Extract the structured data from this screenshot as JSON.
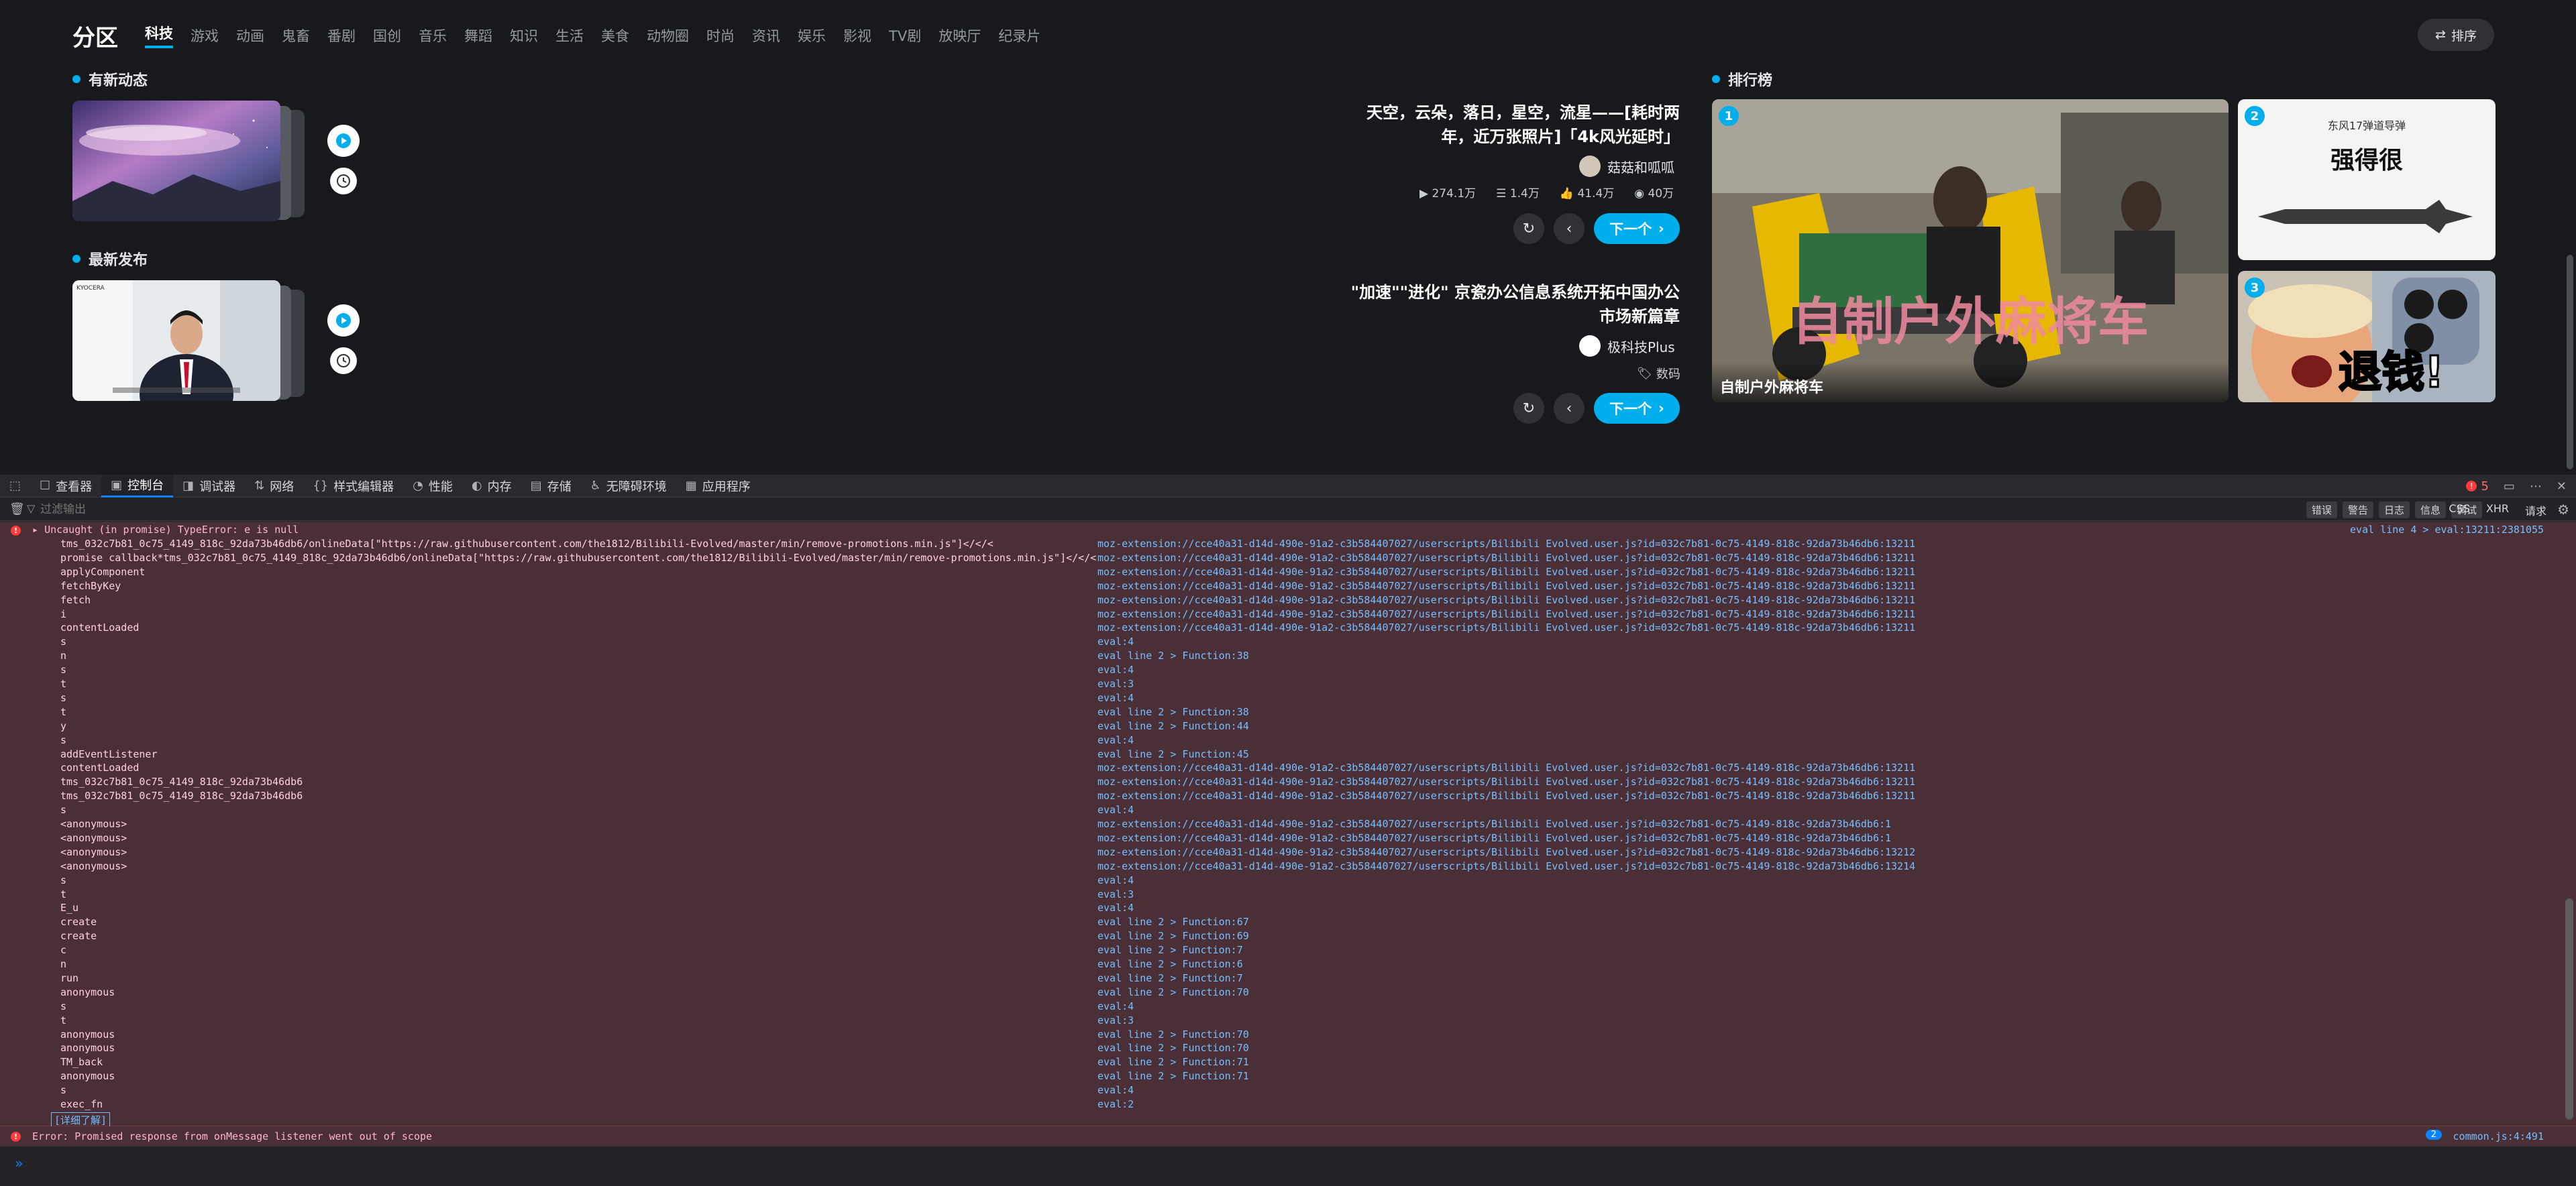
{
  "header": {
    "zone_title": "分区",
    "categories": [
      "科技",
      "游戏",
      "动画",
      "鬼畜",
      "番剧",
      "国创",
      "音乐",
      "舞蹈",
      "知识",
      "生活",
      "美食",
      "动物圈",
      "时尚",
      "资讯",
      "娱乐",
      "影视",
      "TV剧",
      "放映厅",
      "纪录片"
    ],
    "active_category": "科技",
    "sort_label": "排序"
  },
  "sections": {
    "dynamic_title": "有新动态",
    "latest_title": "最新发布",
    "rank_title": "排行榜"
  },
  "dynamic_video": {
    "title_line1": "天空，云朵，落日，星空，流星——[耗时两",
    "title_line2": "年，近万张照片]「4k风光延时」",
    "author": "菇菇和呱呱",
    "stats": {
      "views": "274.1万",
      "danmaku": "1.4万",
      "likes": "41.4万",
      "coins": "40万"
    },
    "next_label": "下一个"
  },
  "latest_video": {
    "title_line1": "\"加速\"\"进化\" 京瓷办公信息系统开拓中国办公",
    "title_line2": "市场新篇章",
    "author": "极科技Plus",
    "tag": "数码",
    "next_label": "下一个"
  },
  "ranking": [
    {
      "rank": "1",
      "caption": "自制户外麻将车",
      "overlay": "自制户外麻将车"
    },
    {
      "rank": "2",
      "top_text": "东风17弹道导弹",
      "big_text": "强得很"
    },
    {
      "rank": "3",
      "overlay": "退钱!"
    }
  ],
  "devtools": {
    "tabs": [
      "查看器",
      "控制台",
      "调试器",
      "网络",
      "样式编辑器",
      "性能",
      "内存",
      "存储",
      "无障碍环境",
      "应用程序"
    ],
    "active_tab": "控制台",
    "error_count": "5",
    "filter_placeholder": "过滤输出",
    "filter_buttons": [
      "错误",
      "警告",
      "日志",
      "信息",
      "调试"
    ],
    "filter_extra": [
      "CSS",
      "XHR",
      "请求"
    ],
    "error_message": "Uncaught (in promise) TypeError: e is null",
    "error_location": "eval line 4 > eval:13211:2381055",
    "stack": [
      {
        "fn": "tms_032c7b81_0c75_4149_818c_92da73b46db6/onlineData[\"https://raw.githubusercontent.com/the1812/Bilibili-Evolved/master/min/remove-promotions.min.js\"]</</<",
        "loc": "moz-extension://cce40a31-d14d-490e-91a2-c3b584407027/userscripts/Bilibili Evolved.user.js?id=032c7b81-0c75-4149-818c-92da73b46db6:13211"
      },
      {
        "fn": "promise callback*tms_032c7b81_0c75_4149_818c_92da73b46db6/onlineData[\"https://raw.githubusercontent.com/the1812/Bilibili-Evolved/master/min/remove-promotions.min.js\"]</</<",
        "loc": "moz-extension://cce40a31-d14d-490e-91a2-c3b584407027/userscripts/Bilibili Evolved.user.js?id=032c7b81-0c75-4149-818c-92da73b46db6:13211"
      },
      {
        "fn": "applyComponent",
        "loc": "moz-extension://cce40a31-d14d-490e-91a2-c3b584407027/userscripts/Bilibili Evolved.user.js?id=032c7b81-0c75-4149-818c-92da73b46db6:13211"
      },
      {
        "fn": "fetchByKey",
        "loc": "moz-extension://cce40a31-d14d-490e-91a2-c3b584407027/userscripts/Bilibili Evolved.user.js?id=032c7b81-0c75-4149-818c-92da73b46db6:13211"
      },
      {
        "fn": "fetch",
        "loc": "moz-extension://cce40a31-d14d-490e-91a2-c3b584407027/userscripts/Bilibili Evolved.user.js?id=032c7b81-0c75-4149-818c-92da73b46db6:13211"
      },
      {
        "fn": "i",
        "loc": "moz-extension://cce40a31-d14d-490e-91a2-c3b584407027/userscripts/Bilibili Evolved.user.js?id=032c7b81-0c75-4149-818c-92da73b46db6:13211"
      },
      {
        "fn": "contentLoaded",
        "loc": "moz-extension://cce40a31-d14d-490e-91a2-c3b584407027/userscripts/Bilibili Evolved.user.js?id=032c7b81-0c75-4149-818c-92da73b46db6:13211"
      },
      {
        "fn": "s",
        "loc": "eval:4"
      },
      {
        "fn": "n",
        "loc": "eval line 2 > Function:38"
      },
      {
        "fn": "s",
        "loc": "eval:4"
      },
      {
        "fn": "t",
        "loc": "eval:3"
      },
      {
        "fn": "s",
        "loc": "eval:4"
      },
      {
        "fn": "t",
        "loc": "eval line 2 > Function:38"
      },
      {
        "fn": "y",
        "loc": "eval line 2 > Function:44"
      },
      {
        "fn": "s",
        "loc": "eval:4"
      },
      {
        "fn": "addEventListener",
        "loc": "eval line 2 > Function:45"
      },
      {
        "fn": "contentLoaded",
        "loc": "moz-extension://cce40a31-d14d-490e-91a2-c3b584407027/userscripts/Bilibili Evolved.user.js?id=032c7b81-0c75-4149-818c-92da73b46db6:13211"
      },
      {
        "fn": "tms_032c7b81_0c75_4149_818c_92da73b46db6",
        "loc": "moz-extension://cce40a31-d14d-490e-91a2-c3b584407027/userscripts/Bilibili Evolved.user.js?id=032c7b81-0c75-4149-818c-92da73b46db6:13211"
      },
      {
        "fn": "tms_032c7b81_0c75_4149_818c_92da73b46db6",
        "loc": "moz-extension://cce40a31-d14d-490e-91a2-c3b584407027/userscripts/Bilibili Evolved.user.js?id=032c7b81-0c75-4149-818c-92da73b46db6:13211"
      },
      {
        "fn": "s",
        "loc": "eval:4"
      },
      {
        "fn": "<anonymous>",
        "loc": "moz-extension://cce40a31-d14d-490e-91a2-c3b584407027/userscripts/Bilibili Evolved.user.js?id=032c7b81-0c75-4149-818c-92da73b46db6:1"
      },
      {
        "fn": "<anonymous>",
        "loc": "moz-extension://cce40a31-d14d-490e-91a2-c3b584407027/userscripts/Bilibili Evolved.user.js?id=032c7b81-0c75-4149-818c-92da73b46db6:1"
      },
      {
        "fn": "<anonymous>",
        "loc": "moz-extension://cce40a31-d14d-490e-91a2-c3b584407027/userscripts/Bilibili Evolved.user.js?id=032c7b81-0c75-4149-818c-92da73b46db6:13212"
      },
      {
        "fn": "<anonymous>",
        "loc": "moz-extension://cce40a31-d14d-490e-91a2-c3b584407027/userscripts/Bilibili Evolved.user.js?id=032c7b81-0c75-4149-818c-92da73b46db6:13214"
      },
      {
        "fn": "s",
        "loc": "eval:4"
      },
      {
        "fn": "t",
        "loc": "eval:3"
      },
      {
        "fn": "E_u",
        "loc": "eval:4"
      },
      {
        "fn": "create",
        "loc": "eval line 2 > Function:67"
      },
      {
        "fn": "create",
        "loc": "eval line 2 > Function:69"
      },
      {
        "fn": "c",
        "loc": "eval line 2 > Function:7"
      },
      {
        "fn": "n",
        "loc": "eval line 2 > Function:6"
      },
      {
        "fn": "run",
        "loc": "eval line 2 > Function:7"
      },
      {
        "fn": "anonymous",
        "loc": "eval line 2 > Function:70"
      },
      {
        "fn": "s",
        "loc": "eval:4"
      },
      {
        "fn": "t",
        "loc": "eval:3"
      },
      {
        "fn": "anonymous",
        "loc": "eval line 2 > Function:70"
      },
      {
        "fn": "anonymous",
        "loc": "eval line 2 > Function:70"
      },
      {
        "fn": "TM_back",
        "loc": "eval line 2 > Function:71"
      },
      {
        "fn": "anonymous",
        "loc": "eval line 2 > Function:71"
      },
      {
        "fn": "s",
        "loc": "eval:4"
      },
      {
        "fn": "exec_fn",
        "loc": "eval:2"
      }
    ],
    "more_link": "[详细了解]",
    "error2_message": "Error: Promised response from onMessage listener went out of scope",
    "error2_count": "2",
    "error2_location": "common.js:4:491",
    "prompt": "»"
  }
}
